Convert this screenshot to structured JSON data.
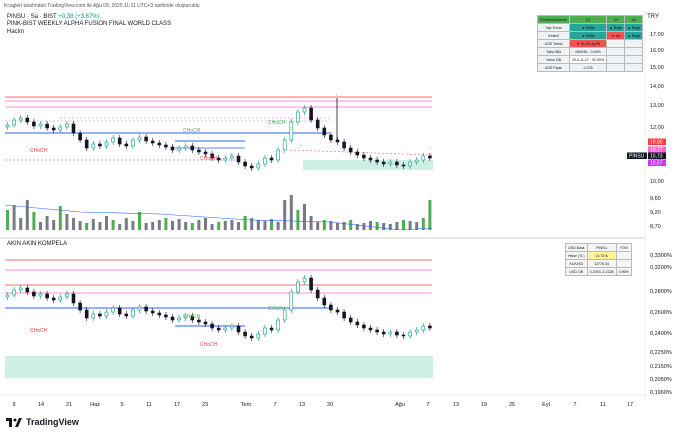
{
  "header": {
    "caption": "Kcagleri tarafından TradingView.com ile Ağu 09, 2025 11:11 UTC+3 tarihinde oluşturuldu"
  },
  "symbol": {
    "name": "PINSU · Sa · BIST",
    "change": "+0,38 (+3,67%)"
  },
  "indicators": {
    "line1": "PINK-BIST WEEKLY ALPHA FUSION FINAL WORLD CLASS",
    "line2": "Hacim"
  },
  "pane2": {
    "title": "AKIN AKIN KOMPELA"
  },
  "currency": "TRY",
  "price_axis": [
    "17,00",
    "16,00",
    "15,00",
    "14,00",
    "13,00",
    "12,00",
    "11,00",
    "10,00",
    "9,60",
    "9,20",
    "8,70",
    "8,30"
  ],
  "price_tags": [
    {
      "v": "10,80",
      "c": "#ff3b3b"
    },
    {
      "v": "10,77",
      "c": "#ff66cc"
    },
    {
      "v": "10,73",
      "c": "#131722"
    },
    {
      "v": "10,57",
      "c": "#cc33ff"
    }
  ],
  "price_label": "PINSU",
  "pane2_axis": [
    "0,3300%",
    "0,3200%",
    "0,2800%",
    "0,2600%",
    "0,2400%",
    "0,2250%",
    "0,2150%",
    "0,2050%",
    "0,1960%"
  ],
  "time_axis": [
    "9",
    "14",
    "21",
    "Haz",
    "5",
    "11",
    "17",
    "23",
    "Tem",
    "7",
    "13",
    "20",
    "Ağu",
    "7",
    "13",
    "19",
    "25",
    "Eyl",
    "7",
    "11",
    "17"
  ],
  "chart_labels": {
    "choch": "CHoCH",
    "i": "i"
  },
  "table1": {
    "header": [
      "Zirveler/Akademi",
      "1G",
      "1H",
      "1A"
    ],
    "rows": [
      [
        "Yap Trend",
        "▲ Boğa",
        "▲ Boğa",
        "▲ Boğa"
      ],
      [
        "Kesinli",
        "▲ Boğa",
        "▼ Ayı",
        "▲ Boğa"
      ],
      [
        "USD Trend",
        "▼ SLOK AyÖlf",
        "",
        ""
      ],
      [
        "Takvi iBlit",
        "069936 - 0.44%",
        "",
        ""
      ],
      [
        "Yakın OB",
        "10,0-11,17 · 92,90%",
        "",
        ""
      ],
      [
        "USD Fiyatı",
        "0.225",
        "",
        ""
      ]
    ]
  },
  "table2": {
    "rows": [
      [
        "USD Bask",
        "PINSU",
        "YÖN"
      ],
      [
        "Hisse (TL)",
        "10,73 ₺",
        ""
      ],
      [
        "KU/USD",
        "13776.34",
        ""
      ],
      [
        "USD OB",
        "0.2053–0.2228",
        "0.96%"
      ]
    ]
  },
  "brand": "TradingView",
  "colors": {
    "up": "#089981",
    "down": "#131722",
    "accent": "#2962ff",
    "pink": "#ff66cc",
    "green": "#4caf50",
    "zone": "#cfeee4"
  }
}
